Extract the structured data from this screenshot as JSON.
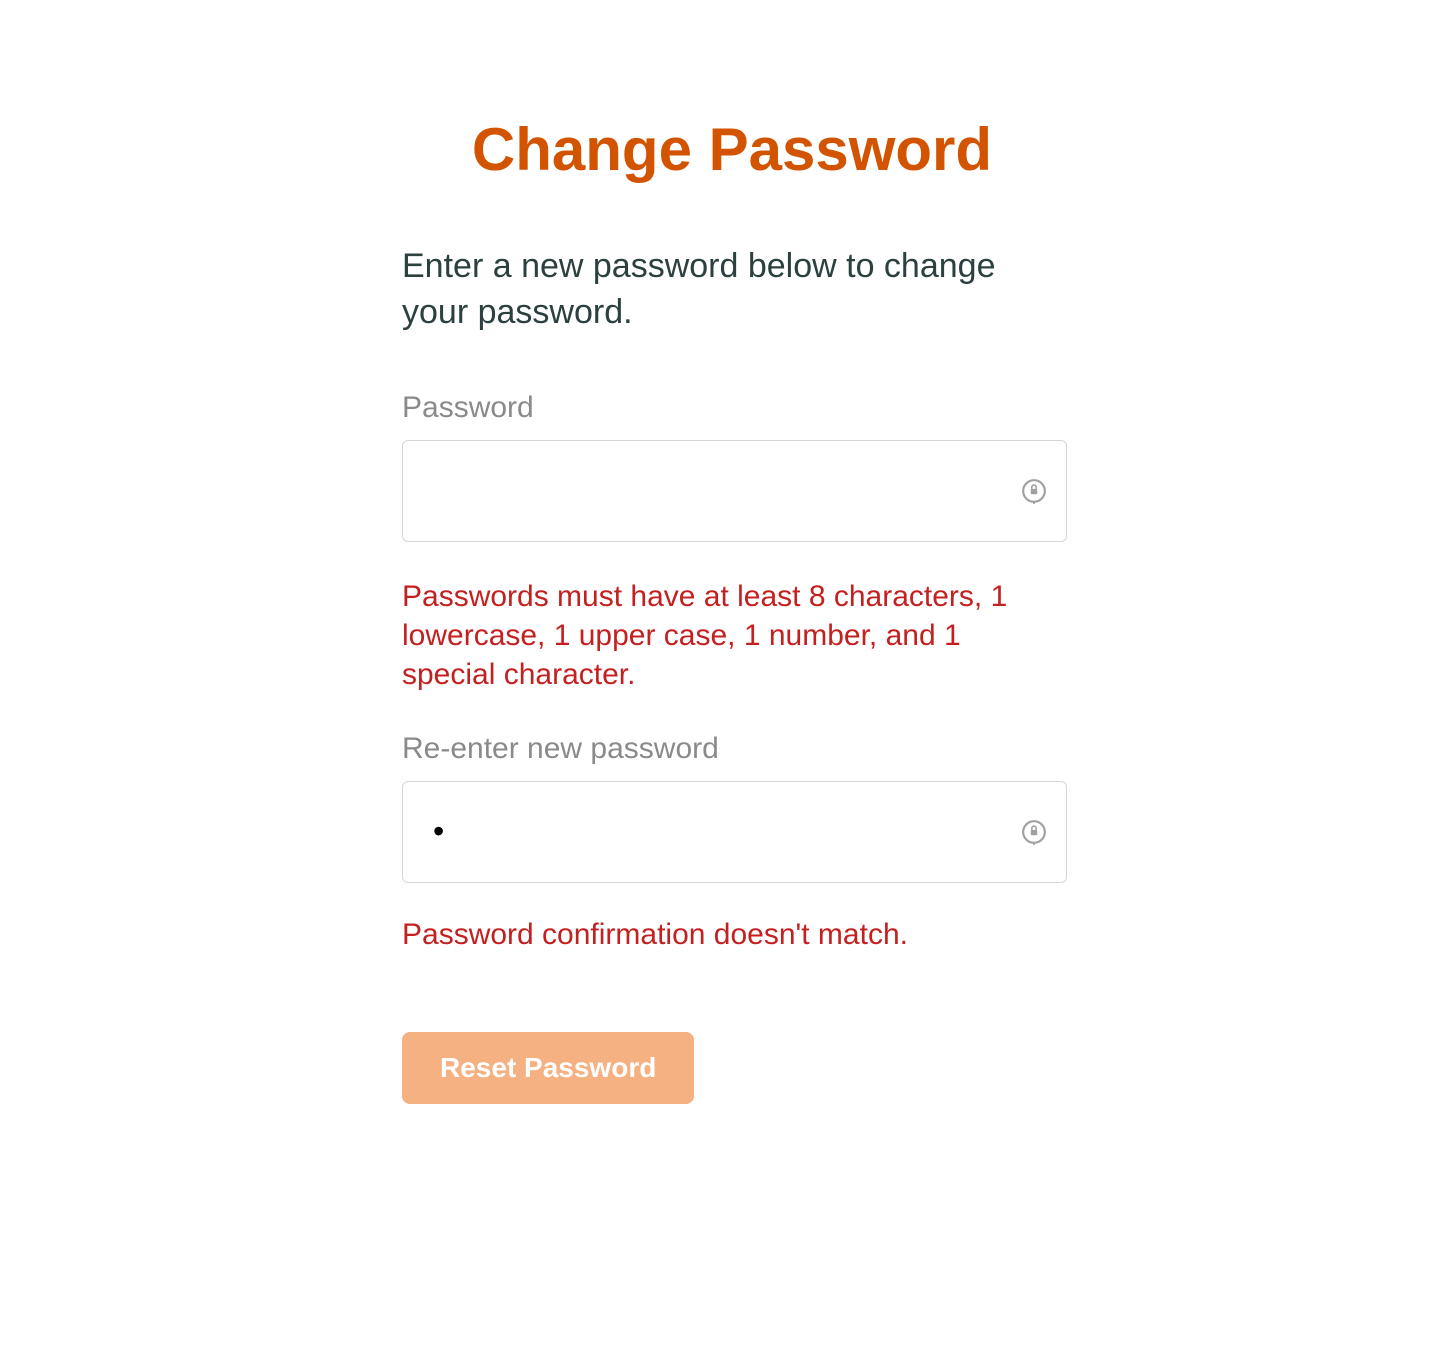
{
  "title": "Change Password",
  "instruction": "Enter a new password below to change your password.",
  "fields": {
    "password": {
      "label": "Password",
      "value": "",
      "error": "Passwords must have at least 8 characters, 1 lowercase, 1 upper case, 1 number, and 1 special character."
    },
    "confirm": {
      "label": "Re-enter new password",
      "value": "•",
      "error": "Password confirmation doesn't match."
    }
  },
  "button": {
    "reset_label": "Reset Password"
  },
  "colors": {
    "accent": "#d35400",
    "button_bg": "#f5b181",
    "error": "#c42020",
    "text_dark": "#2c4040",
    "text_muted": "#8a8a8a"
  }
}
